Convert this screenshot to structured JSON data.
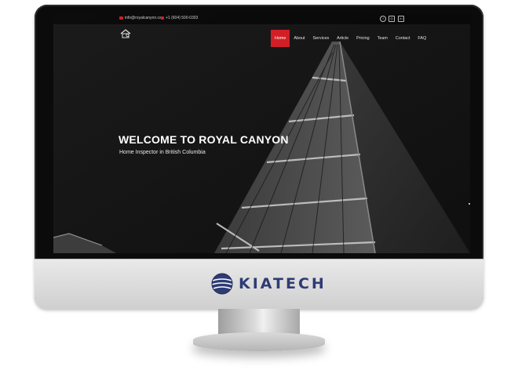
{
  "topbar": {
    "email": "info@royalcanyon.ca",
    "phone": "+1 (604) 500-0303",
    "social": [
      {
        "icon": "facebook-icon",
        "glyph": "f"
      },
      {
        "icon": "instagram-icon",
        "glyph": "◎"
      },
      {
        "icon": "linkedin-icon",
        "glyph": "in"
      }
    ]
  },
  "nav": {
    "items": [
      "Home",
      "About",
      "Services",
      "Article",
      "Pricing",
      "Team",
      "Contact",
      "FAQ"
    ],
    "active_index": 0,
    "accent_color": "#d21f26"
  },
  "hero": {
    "title": "WELCOME TO ROYAL CANYON",
    "subtitle": "Home Inspector in British Columbia"
  },
  "brand": {
    "name": "KIATECH",
    "color": "#2e3c74"
  }
}
